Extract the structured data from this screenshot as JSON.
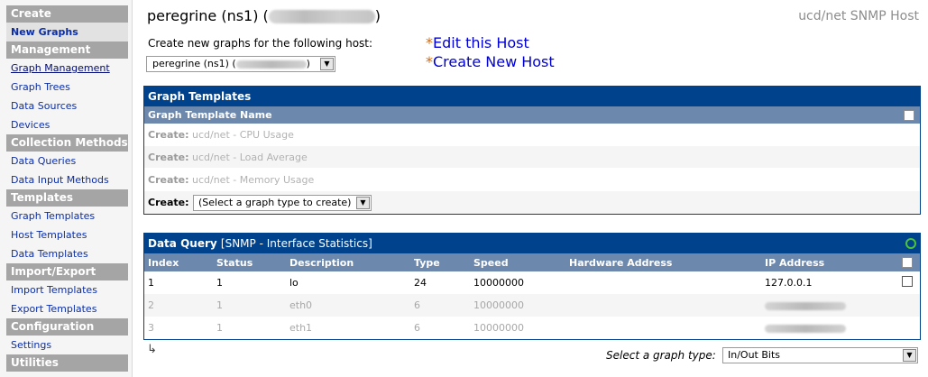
{
  "sidebar": {
    "sections": [
      {
        "heading": "Create",
        "items": [
          {
            "label": "New Graphs",
            "active": true
          }
        ]
      },
      {
        "heading": "Management",
        "items": [
          {
            "label": "Graph Management"
          },
          {
            "label": "Graph Trees"
          },
          {
            "label": "Data Sources"
          },
          {
            "label": "Devices"
          }
        ]
      },
      {
        "heading": "Collection Methods",
        "items": [
          {
            "label": "Data Queries"
          },
          {
            "label": "Data Input Methods"
          }
        ]
      },
      {
        "heading": "Templates",
        "items": [
          {
            "label": "Graph Templates"
          },
          {
            "label": "Host Templates"
          },
          {
            "label": "Data Templates"
          }
        ]
      },
      {
        "heading": "Import/Export",
        "items": [
          {
            "label": "Import Templates"
          },
          {
            "label": "Export Templates"
          }
        ]
      },
      {
        "heading": "Configuration",
        "items": [
          {
            "label": "Settings"
          }
        ]
      },
      {
        "heading": "Utilities",
        "items": []
      }
    ]
  },
  "header": {
    "host_name": "peregrine (ns1) (",
    "host_close": ")",
    "host_type": "ucd/net SNMP Host",
    "create_label": "Create new graphs for the following host:",
    "host_select_value": "peregrine (ns1) (",
    "host_select_close": ")",
    "edit_link": "Edit this Host",
    "create_link": "Create New Host",
    "link_star": "*"
  },
  "graph_templates": {
    "title": "Graph Templates",
    "column_header": "Graph Template Name",
    "rows": [
      {
        "prefix": "Create:",
        "name": "ucd/net - CPU Usage"
      },
      {
        "prefix": "Create:",
        "name": "ucd/net - Load Average"
      },
      {
        "prefix": "Create:",
        "name": "ucd/net - Memory Usage"
      }
    ],
    "create_label": "Create:",
    "create_select": "(Select a graph type to create)"
  },
  "data_query": {
    "title": "Data Query",
    "subtitle": "[SNMP - Interface Statistics]",
    "columns": [
      "Index",
      "Status",
      "Description",
      "Type",
      "Speed",
      "Hardware Address",
      "IP Address"
    ],
    "rows": [
      {
        "index": "1",
        "status": "1",
        "description": "lo",
        "type": "24",
        "speed": "10000000",
        "hw": "",
        "ip": "127.0.0.1"
      },
      {
        "index": "2",
        "status": "1",
        "description": "eth0",
        "type": "6",
        "speed": "10000000",
        "hw": "",
        "ip": ""
      },
      {
        "index": "3",
        "status": "1",
        "description": "eth1",
        "type": "6",
        "speed": "10000000",
        "hw": "",
        "ip": ""
      }
    ],
    "graph_type_label": "Select a graph type:",
    "graph_type_value": "In/Out Bits"
  },
  "icons": {
    "return_arrow": "↳",
    "dropdown_arrow": "▼"
  }
}
